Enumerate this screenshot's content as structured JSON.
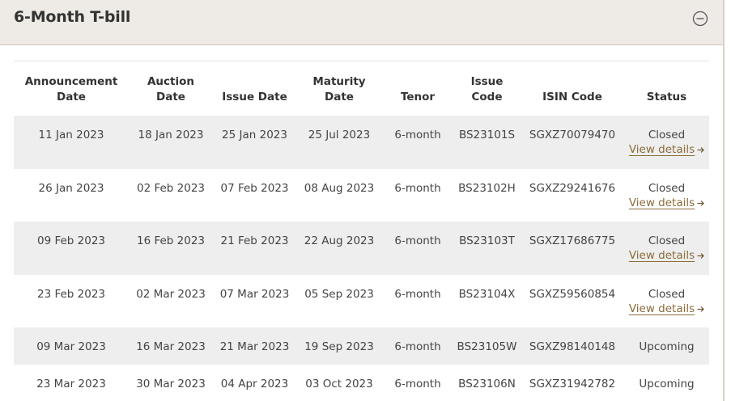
{
  "panel": {
    "title": "6-Month T-bill",
    "collapse_icon": "minus-circle-icon"
  },
  "table": {
    "headers": [
      "Announcement Date",
      "Auction Date",
      "Issue Date",
      "Maturity Date",
      "Tenor",
      "Issue Code",
      "ISIN Code",
      "Status"
    ],
    "header_lines": [
      [
        "Announcement",
        "Date"
      ],
      [
        "Auction",
        "Date"
      ],
      [
        "Issue Date"
      ],
      [
        "Maturity",
        "Date"
      ],
      [
        "Tenor"
      ],
      [
        "Issue",
        "Code"
      ],
      [
        "ISIN Code"
      ],
      [
        "Status"
      ]
    ],
    "rows": [
      {
        "announcement": "11 Jan 2023",
        "auction": "18 Jan 2023",
        "issue": "25 Jan 2023",
        "maturity": "25 Jul 2023",
        "tenor": "6-month",
        "code": "BS23101S",
        "isin": "SGXZ70079470",
        "status": "Closed",
        "link": "View details"
      },
      {
        "announcement": "26 Jan 2023",
        "auction": "02 Feb 2023",
        "issue": "07 Feb 2023",
        "maturity": "08 Aug 2023",
        "tenor": "6-month",
        "code": "BS23102H",
        "isin": "SGXZ29241676",
        "status": "Closed",
        "link": "View details"
      },
      {
        "announcement": "09 Feb 2023",
        "auction": "16 Feb 2023",
        "issue": "21 Feb 2023",
        "maturity": "22 Aug 2023",
        "tenor": "6-month",
        "code": "BS23103T",
        "isin": "SGXZ17686775",
        "status": "Closed",
        "link": "View details"
      },
      {
        "announcement": "23 Feb 2023",
        "auction": "02 Mar 2023",
        "issue": "07 Mar 2023",
        "maturity": "05 Sep 2023",
        "tenor": "6-month",
        "code": "BS23104X",
        "isin": "SGXZ59560854",
        "status": "Closed",
        "link": "View details"
      },
      {
        "announcement": "09 Mar 2023",
        "auction": "16 Mar 2023",
        "issue": "21 Mar 2023",
        "maturity": "19 Sep 2023",
        "tenor": "6-month",
        "code": "BS23105W",
        "isin": "SGXZ98140148",
        "status": "Upcoming",
        "link": ""
      },
      {
        "announcement": "23 Mar 2023",
        "auction": "30 Mar 2023",
        "issue": "04 Apr 2023",
        "maturity": "03 Oct 2023",
        "tenor": "6-month",
        "code": "BS23106N",
        "isin": "SGXZ31942782",
        "status": "Upcoming",
        "link": ""
      }
    ]
  },
  "colors": {
    "header_bg": "#eeeae6",
    "row_shade": "#eeeeee",
    "link": "#8a6d3b"
  }
}
